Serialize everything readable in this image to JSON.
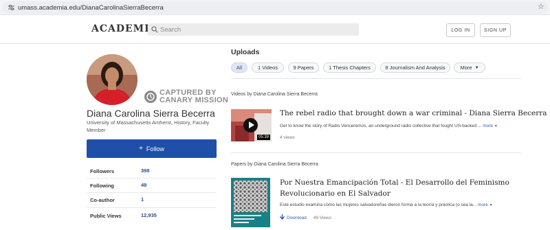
{
  "browser": {
    "url": "umass.academia.edu/DianaCarolinaSierraBecerra"
  },
  "header": {
    "logo": "ACADEMIA",
    "search_placeholder": "Search",
    "login": "LOG IN",
    "signup": "SIGN UP"
  },
  "watermark": {
    "line1": "CAPTURED BY",
    "line2": "CANARY MISSION"
  },
  "profile": {
    "name": "Diana Carolina Sierra Becerra",
    "affiliation": "University of Massachusetts Amherst, History, Faculty Member",
    "follow_label": "Follow",
    "stats": [
      {
        "label": "Followers",
        "value": "398"
      },
      {
        "label": "Following",
        "value": "49"
      },
      {
        "label": "Co-author",
        "value": "1"
      },
      {
        "label": "Public Views",
        "value": "12,935"
      }
    ]
  },
  "main": {
    "heading": "Uploads",
    "filters": [
      "All",
      "1 Videos",
      "9 Papers",
      "1 Thesis Chapters",
      "8 Journalism And Analysis",
      "More"
    ],
    "videos_section": "Videos by Diana Carolina Sierra Becerra",
    "video": {
      "title": "The rebel radio that brought down a war criminal - Diana Sierra Becerra",
      "description": "Get to know the story of Radio Venceremos, an underground radio collective that fought US-backed ...",
      "more": "more",
      "duration": "05:39",
      "views": "4 views"
    },
    "papers_section": "Papers by Diana Carolina Sierra Becerra",
    "paper": {
      "title_line1": "Por Nuestra Emancipación Total - El Desarrollo del Feminismo",
      "title_line2": "Revolucionario en El Salvador",
      "description": "Este estudio examina cómo las mujeres salvadoreñas dieron forma a la teoría y práctica (o sea la...",
      "more": "more",
      "download": "Download",
      "views": "49 Views"
    }
  }
}
